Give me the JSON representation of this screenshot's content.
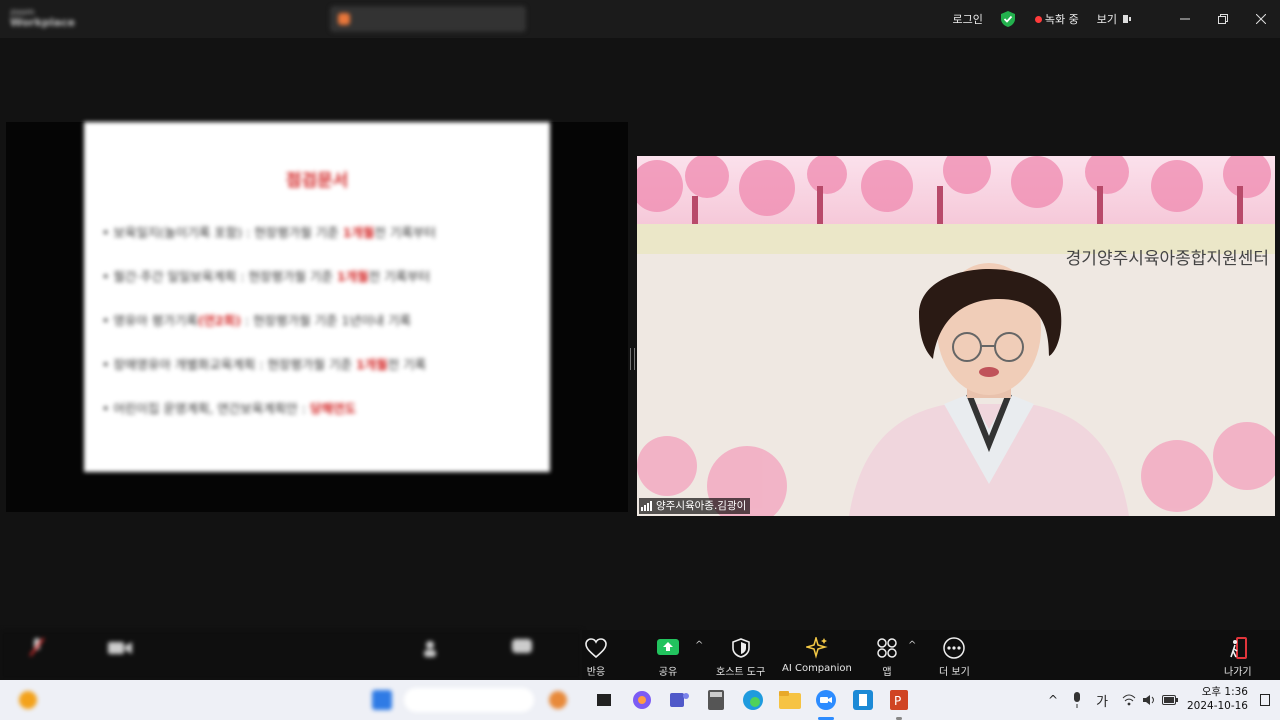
{
  "titlebar": {
    "app_name_top": "zoom",
    "app_name": "Workplace",
    "login": "로그인",
    "recording": "녹화 중",
    "view": "보기"
  },
  "slide": {
    "title": "점검문서",
    "lines": [
      {
        "pre": "• 보육일지(놀이기록 포함) : 현장평가월 기준 ",
        "red": "1개월",
        "post": "전 기록부터"
      },
      {
        "pre": "• 월간·주간 일일보육계획 : 현장평가월 기준 ",
        "red": "1개월",
        "post": "전 기록부터"
      },
      {
        "pre": "• 영유아 평가기록",
        "red": "(연2회)",
        "post": " : 현장평가월 기준 1년이내 기록"
      },
      {
        "pre": "• 장애영유아 개별화교육계획 : 현장평가월 기준 ",
        "red": "1개월",
        "post": "전 기록"
      },
      {
        "pre": "• 어린이집 운영계획, 연간보육계획안 : ",
        "red": "당해연도",
        "post": ""
      }
    ]
  },
  "video": {
    "org_banner": "경기양주시육아종합지원센터",
    "participant_name": "양주시육아종.김광이"
  },
  "toolbar": {
    "reactions": "반응",
    "share": "공유",
    "host_tools": "호스트 도구",
    "ai_companion": "AI Companion",
    "apps": "앱",
    "more": "더 보기",
    "leave": "나가기"
  },
  "taskbar": {
    "ime": "가",
    "time": "오후 1:36",
    "date": "2024-10-16"
  },
  "colors": {
    "share_green": "#22c35e",
    "leave_red": "#e0353b",
    "ai_star": "#f3c845",
    "slide_red": "#d42a2a"
  }
}
